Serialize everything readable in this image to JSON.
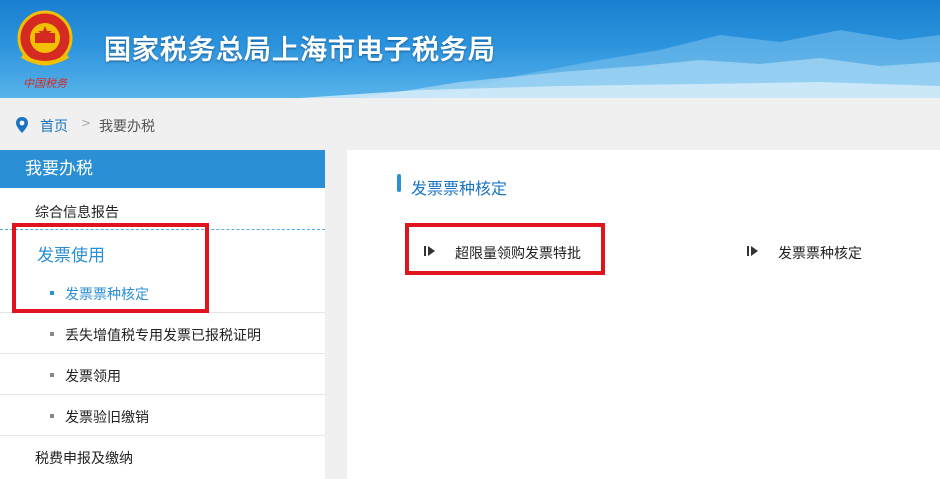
{
  "header": {
    "title": "国家税务总局上海市电子税务局",
    "emblem_caption": "中国税务",
    "icon": "tax-emblem-icon"
  },
  "breadcrumb": {
    "home": "首页",
    "separator": ">",
    "current": "我要办税"
  },
  "sidebar": {
    "heading": "我要办税",
    "items": [
      {
        "label": "综合信息报告"
      },
      {
        "label": "发票使用"
      },
      {
        "label": "发票票种核定",
        "active": true
      },
      {
        "label": "丢失增值税专用发票已报税证明"
      },
      {
        "label": "发票领用"
      },
      {
        "label": "发票验旧缴销"
      },
      {
        "label": "税费申报及缴纳"
      }
    ]
  },
  "content": {
    "section_title": "发票票种核定",
    "links": [
      {
        "label": "超限量领购发票特批"
      },
      {
        "label": "发票票种核定"
      }
    ]
  },
  "colors": {
    "accent": "#2b8fd6",
    "highlight": "#e0141c"
  }
}
